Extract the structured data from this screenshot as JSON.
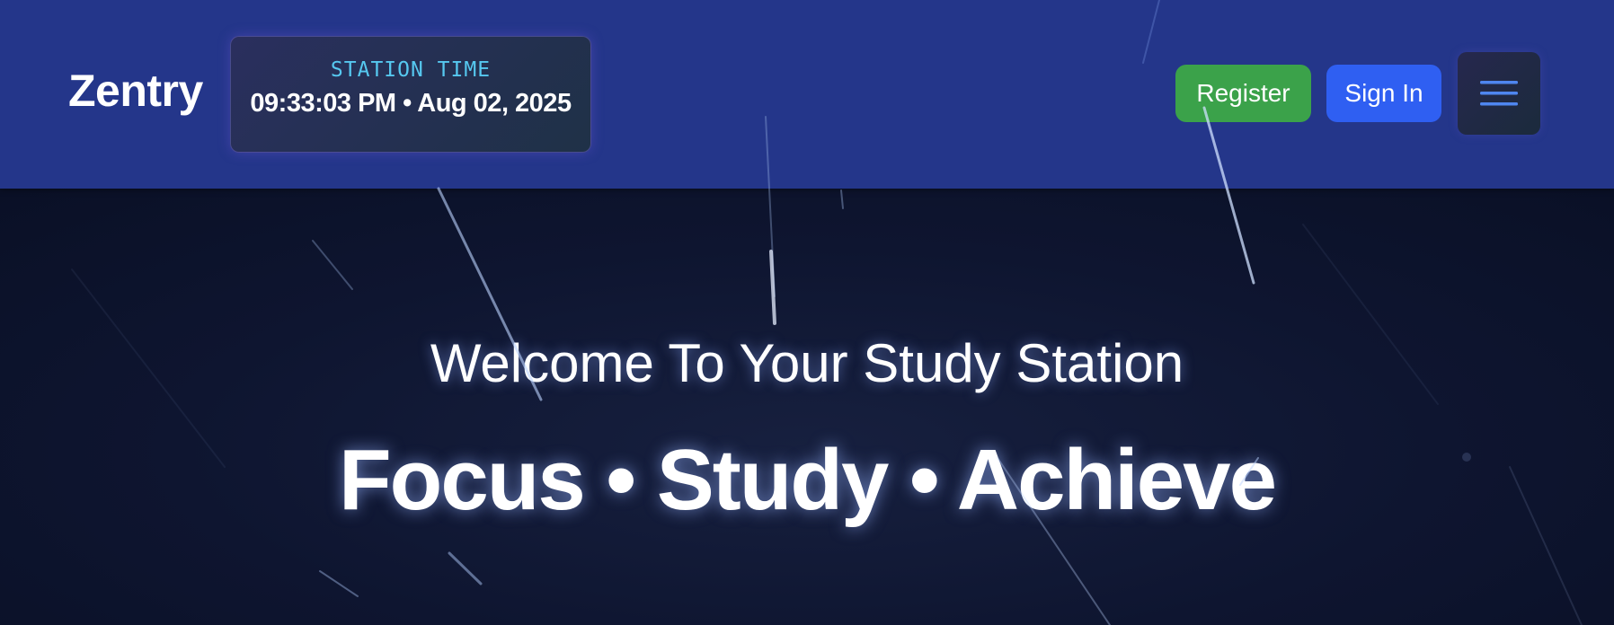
{
  "header": {
    "brand": "Zentry",
    "clock": {
      "label": "STATION TIME",
      "value": "09:33:03 PM • Aug 02, 2025"
    },
    "register_label": "Register",
    "signin_label": "Sign In",
    "menu_icon": "hamburger-menu-icon"
  },
  "hero": {
    "subtitle": "Welcome To Your Study Station",
    "title": "Focus • Study • Achieve"
  },
  "colors": {
    "header_bg": "#24368a",
    "hero_bg": "#0e1530",
    "register": "#3ba24a",
    "signin": "#2f5ff2",
    "clock_label": "#56c8f0"
  }
}
